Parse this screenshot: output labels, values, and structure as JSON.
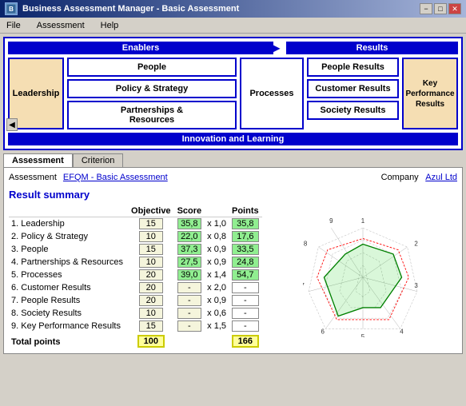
{
  "window": {
    "title": "Business Assessment Manager - Basic Assessment",
    "icon": "BA"
  },
  "titleButtons": {
    "minimize": "−",
    "maximize": "□",
    "close": "✕"
  },
  "menu": {
    "items": [
      "File",
      "Assessment",
      "Help"
    ]
  },
  "nav": {
    "enablersLabel": "Enablers",
    "resultsLabel": "Results",
    "leadershipLabel": "Leadership",
    "peopleLabel": "People",
    "policyLabel": "Policy & Strategy",
    "partnershipsLabel": "Partnerships &\nResources",
    "processesLabel": "Processes",
    "peopleResultsLabel": "People Results",
    "customerResultsLabel": "Customer Results",
    "societyResultsLabel": "Society Results",
    "kprLabel": "Key Performance Results",
    "innovationLabel": "Innovation and Learning"
  },
  "tabs": {
    "items": [
      "Assessment",
      "Criterion"
    ]
  },
  "assessmentInfo": {
    "assessmentLabel": "Assessment",
    "assessmentValue": "EFQM - Basic Assessment",
    "companyLabel": "Company",
    "companyValue": "Azul Ltd"
  },
  "resultSummary": {
    "title": "Result summary",
    "headers": {
      "objective": "Objective",
      "score": "Score",
      "points": "Points"
    },
    "rows": [
      {
        "num": "1.",
        "label": "Leadership",
        "objective": "15",
        "score": "35,8",
        "multiplier": "x 1,0",
        "points": "35,8"
      },
      {
        "num": "2.",
        "label": "Policy & Strategy",
        "objective": "10",
        "score": "22,0",
        "multiplier": "x 0,8",
        "points": "17,6"
      },
      {
        "num": "3.",
        "label": "People",
        "objective": "15",
        "score": "37,3",
        "multiplier": "x 0,9",
        "points": "33,5"
      },
      {
        "num": "4.",
        "label": "Partnerships & Resources",
        "objective": "10",
        "score": "27,5",
        "multiplier": "x 0,9",
        "points": "24,8"
      },
      {
        "num": "5.",
        "label": "Processes",
        "objective": "20",
        "score": "39,0",
        "multiplier": "x 1,4",
        "points": "54,7"
      },
      {
        "num": "6.",
        "label": "Customer Results",
        "objective": "20",
        "score": "-",
        "multiplier": "x 2,0",
        "points": "-"
      },
      {
        "num": "7.",
        "label": "People Results",
        "objective": "20",
        "score": "-",
        "multiplier": "x 0,9",
        "points": "-"
      },
      {
        "num": "8.",
        "label": "Society Results",
        "objective": "10",
        "score": "-",
        "multiplier": "x 0,6",
        "points": "-"
      },
      {
        "num": "9.",
        "label": "Key Performance Results",
        "objective": "15",
        "score": "-",
        "multiplier": "x 1,5",
        "points": "-"
      }
    ],
    "total": {
      "label": "Total points",
      "objective": "100",
      "points": "166"
    }
  }
}
